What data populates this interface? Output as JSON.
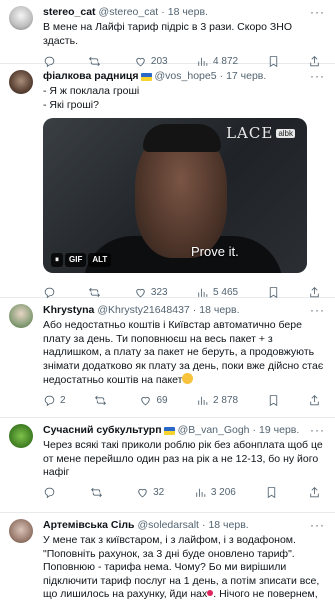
{
  "tweets": [
    {
      "name": "stereo_cat",
      "handle": "@stereo_cat",
      "time": "18 черв.",
      "lines": [
        "В мене на Лайфі тариф підріс в 3 рази. Скоро ЗНО здасть."
      ],
      "replies": "",
      "retweets": "",
      "likes": "203",
      "views": "4 872"
    },
    {
      "name": "фіалкова радниця",
      "handle": "@vos_hope5",
      "time": "17 черв.",
      "lines": [
        "- Я ж поклала гроші",
        "- Які гроші?"
      ],
      "media": {
        "subtitle": "Prove it.",
        "logo": "LACE",
        "logo_badge": "albk",
        "badges": [
          "⏸",
          "GIF",
          "ALT"
        ]
      },
      "replies": "",
      "retweets": "",
      "likes": "323",
      "views": "5 465"
    },
    {
      "name": "Khrystyna",
      "handle": "@Khrysty21648437",
      "time": "18 черв.",
      "lines": [
        "Або недостатньо коштів і Київстар автоматично бере плату за день. Ти поповнюєш на весь пакет + з надлишком, а плату за пакет не беруть, а продовжують знімати додатково як плату за день, поки вже дійсно стає недостатньо коштів на пакет"
      ],
      "replies": "2",
      "retweets": "",
      "likes": "69",
      "views": "2 878"
    },
    {
      "name": "Сучасний субкультурп",
      "handle": "@B_van_Gogh",
      "time": "19 черв.",
      "lines": [
        "Через всякі такі приколи роблю рік без абонплата щоб це от мене перейшло один раз на рік а не 12-13, бо ну його нафіг"
      ],
      "replies": "",
      "retweets": "",
      "likes": "32",
      "views": "3 206"
    },
    {
      "name": "Артемівська Сіль",
      "handle": "@soledarsalt",
      "time": "18 черв.",
      "lines": [
        "У мене так з київстаром, і з лайфом, і з водафоном. \"Поповніть рахунок, за 3 дні буде оновлено тариф\". Поповнюю - тарифа нема. Чому? Бо ми вирішили підключити тариф послуг на 1 день, а потім зписати все, що лишилось на рахунку, йди нах",
        "Нічого не повернем, бо"
      ],
      "replies": "",
      "retweets": "",
      "likes": "",
      "views": ""
    }
  ],
  "colors": {
    "text": "#0f1419",
    "secondary": "#536471",
    "divider": "#e7e9ea",
    "flag_blue": "#2a68c8",
    "flag_yellow": "#f6d32d"
  },
  "icons": [
    "reply-icon",
    "retweet-icon",
    "like-icon",
    "views-icon",
    "bookmark-icon",
    "share-icon",
    "more-icon"
  ]
}
